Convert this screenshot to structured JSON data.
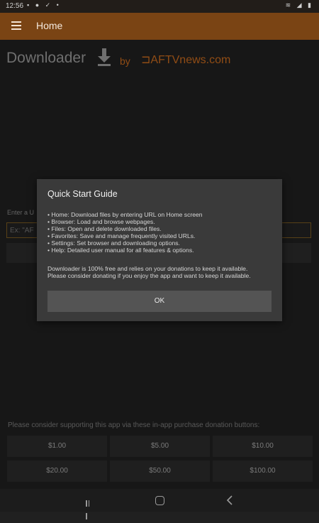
{
  "status_bar": {
    "time": "12:56",
    "left_icons": "▪ ● ✓ •",
    "right_icons": "≋ ◢ ▮"
  },
  "app_bar": {
    "title": "Home",
    "menu_icon": "hamburger-icon"
  },
  "logo": {
    "word": "Downloader",
    "by": "by",
    "brand": "⊐AFTVnews.com"
  },
  "home": {
    "enter_label": "Enter a U",
    "url_placeholder": "Ex: \"AF"
  },
  "support": {
    "text": "Please consider supporting this app via these in-app purchase donation buttons:",
    "buttons": [
      "$1.00",
      "$5.00",
      "$10.00",
      "$20.00",
      "$50.00",
      "$100.00"
    ]
  },
  "dialog": {
    "title": "Quick Start Guide",
    "items": [
      "• Home: Download files by entering URL on Home screen",
      "• Browser: Load and browse webpages.",
      "• Files: Open and delete downloaded files.",
      "• Favorites: Save and manage frequently visited URLs.",
      "• Settings: Set browser and downloading options.",
      "• Help: Detailed user manual for all features & options."
    ],
    "paragraph_1": "Downloader is 100% free and relies on your donations to keep it available.",
    "paragraph_2": "Please consider donating if you enjoy the app and want to keep it available.",
    "ok_label": "OK"
  },
  "colors": {
    "app_bar": "#7a4414",
    "brand": "#c86a1e",
    "background": "#202020"
  }
}
